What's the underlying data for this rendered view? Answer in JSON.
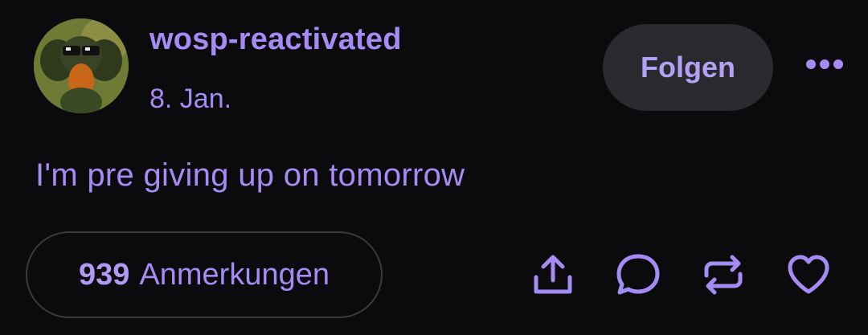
{
  "post": {
    "username": "wosp-reactivated",
    "date": "8. Jan.",
    "text": "I'm pre giving up on tomorrow",
    "follow_label": "Folgen",
    "notes_count": "939",
    "notes_label": "Anmerkungen"
  },
  "icons": {
    "more": "more-horizontal-icon",
    "share": "share-icon",
    "reply": "reply-bubble-icon",
    "reblog": "reblog-icon",
    "like": "heart-icon"
  },
  "colors": {
    "background": "#0b0a0c",
    "accent": "#a58cf5",
    "button_bg": "#2a292e",
    "border": "#3a393f"
  }
}
